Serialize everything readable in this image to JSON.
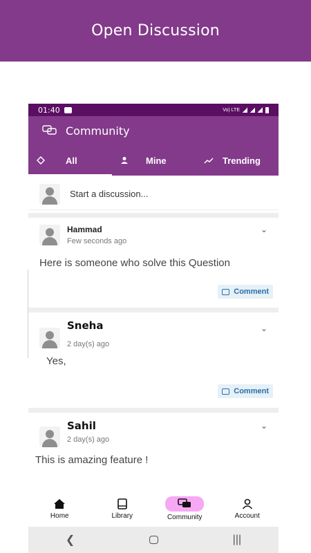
{
  "banner": {
    "title": "Open Discussion"
  },
  "status_bar": {
    "time": "01:40",
    "carrier": "Vo) LTE"
  },
  "app_bar": {
    "title": "Community"
  },
  "tabs": [
    {
      "label": "All",
      "icon": "layers-icon",
      "active": true
    },
    {
      "label": "Mine",
      "icon": "person-icon",
      "active": false
    },
    {
      "label": "Trending",
      "icon": "trending-icon",
      "active": false
    }
  ],
  "start_discussion": {
    "placeholder": "Start a discussion..."
  },
  "posts": [
    {
      "author": "Hammad",
      "time": "Few seconds ago",
      "content": "Here is someone who solve this Question",
      "comment_label": "Comment"
    },
    {
      "author": "Sneha",
      "time": "2 day(s) ago",
      "content": "Yes,",
      "comment_label": "Comment"
    },
    {
      "author": "Sahil",
      "time": "2 day(s) ago",
      "content": "This is amazing feature !"
    }
  ],
  "bottom_nav": [
    {
      "label": "Home",
      "icon": "home-icon",
      "active": false
    },
    {
      "label": "Library",
      "icon": "book-icon",
      "active": false
    },
    {
      "label": "Community",
      "icon": "chat-icon",
      "active": true
    },
    {
      "label": "Account",
      "icon": "account-icon",
      "active": false
    }
  ],
  "colors": {
    "primary": "#833a8a",
    "status_bar": "#5a0f63",
    "accent_pill": "#f7a8f4",
    "comment_button": "#e6f0f7"
  }
}
